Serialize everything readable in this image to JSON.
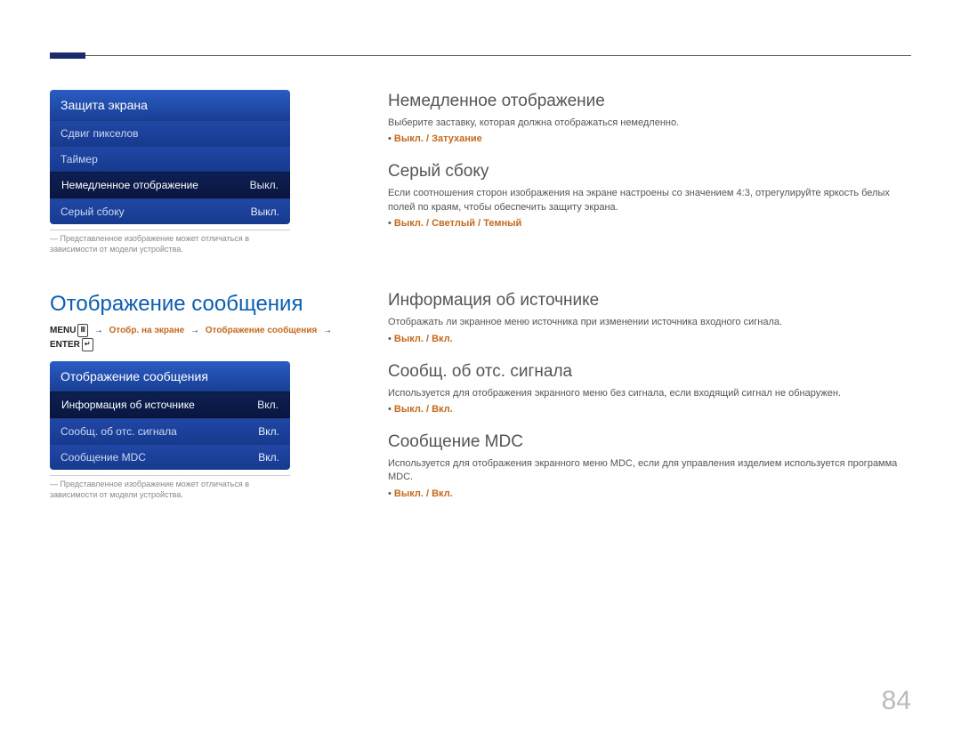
{
  "osd1": {
    "title": "Защита экрана",
    "rows": [
      {
        "label": "Сдвиг пикселов",
        "value": ""
      },
      {
        "label": "Таймер",
        "value": ""
      },
      {
        "label": "Немедленное отображение",
        "value": "Выкл.",
        "selected": true
      },
      {
        "label": "Серый сбоку",
        "value": "Выкл."
      }
    ]
  },
  "osd2": {
    "title": "Отображение сообщения",
    "rows": [
      {
        "label": "Информация об источнике",
        "value": "Вкл.",
        "selected": true
      },
      {
        "label": "Сообщ. об отс. сигнала",
        "value": "Вкл."
      },
      {
        "label": "Сообщение MDC",
        "value": "Вкл."
      }
    ]
  },
  "footnote": "Представленное изображение может отличаться в зависимости от модели устройства.",
  "leftSectionTitle": "Отображение сообщения",
  "breadcrumb": {
    "menu": "MENU",
    "p1": "Отобр. на экране",
    "p2": "Отображение сообщения",
    "enter": "ENTER"
  },
  "sections": [
    {
      "title": "Немедленное отображение",
      "desc": "Выберите заставку, которая должна отображаться немедленно.",
      "options": "Выкл. / Затухание"
    },
    {
      "title": "Серый сбоку",
      "desc": "Если соотношения сторон изображения на экране настроены со значением 4:3, отрегулируйте яркость белых полей по краям, чтобы обеспечить защиту экрана.",
      "options": "Выкл. / Светлый / Темный"
    }
  ],
  "sections2": [
    {
      "title": "Информация об источнике",
      "desc": "Отображать ли экранное меню источника при изменении источника входного сигнала.",
      "options": "Выкл. / Вкл."
    },
    {
      "title": "Сообщ. об отс. сигнала",
      "desc": "Используется для отображения экранного меню без сигнала, если входящий сигнал не обнаружен.",
      "options": "Выкл. / Вкл."
    },
    {
      "title": "Сообщение MDC",
      "desc": "Используется для отображения экранного меню MDC, если для управления изделием используется программа MDC.",
      "options": "Выкл. / Вкл."
    }
  ],
  "pageNumber": "84"
}
